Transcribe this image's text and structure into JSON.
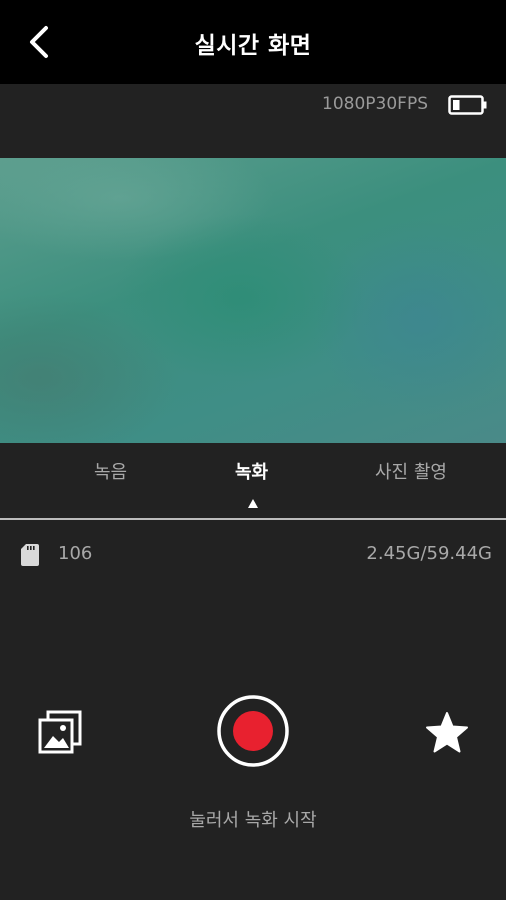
{
  "header": {
    "title": "실시간 화면",
    "back_icon": "chevron-left-icon"
  },
  "status": {
    "resolution": "1080P30FPS",
    "battery_icon": "battery-low-icon",
    "battery_level": 0.25
  },
  "mode_tabs": {
    "items": [
      {
        "label": "녹음",
        "active": false
      },
      {
        "label": "녹화",
        "active": true
      },
      {
        "label": "사진 촬영",
        "active": false
      }
    ],
    "indicator_icon": "triangle-up-icon"
  },
  "storage": {
    "sd_icon": "sd-card-icon",
    "file_count": "106",
    "usage": "2.45G/59.44G"
  },
  "controls": {
    "gallery_icon": "gallery-icon",
    "record_icon": "record-icon",
    "favorite_icon": "star-icon",
    "record_color": "#e8212f",
    "hint": "눌러서 녹화 시작"
  },
  "colors": {
    "header_bg": "#000000",
    "body_bg": "#222222",
    "accent_record": "#e8212f"
  }
}
